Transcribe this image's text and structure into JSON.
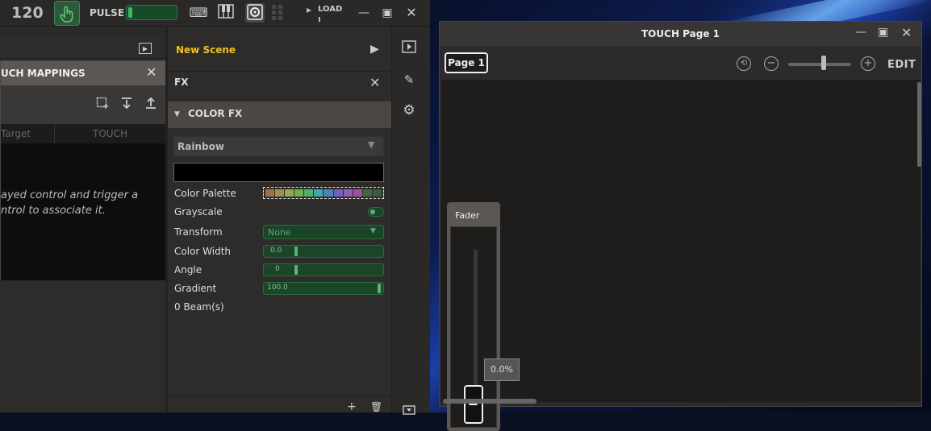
{
  "topbar": {
    "bpm": "120",
    "pulse_label": "PULSE",
    "load_label": "LOAD",
    "tools": [
      "keyboard-icon",
      "piano-icon",
      "speaker-icon",
      "grid-icon"
    ]
  },
  "mappings": {
    "title": "UCH MAPPINGS",
    "col_target": "Target",
    "col_touch": "TOUCH",
    "hint_line1": "ayed control and trigger a",
    "hint_line2": "ntrol to associate it."
  },
  "scene": {
    "title": "New Scene"
  },
  "fx": {
    "title": "FX",
    "section": "COLOR FX",
    "preset": "Rainbow",
    "props": {
      "color_palette": "Color Palette",
      "grayscale": "Grayscale",
      "transform": "Transform",
      "transform_value": "None",
      "color_width": "Color Width",
      "color_width_value": "0.0",
      "angle": "Angle",
      "angle_value": "0",
      "gradient": "Gradient",
      "gradient_value": "100.0",
      "beams": "0 Beam(s)"
    },
    "palette_colors": [
      "#a0704a",
      "#a09050",
      "#98a850",
      "#70b050",
      "#50b070",
      "#40a8a0",
      "#5080b8",
      "#7060b8",
      "#9060b0",
      "#a050a0",
      "#406840",
      "#405840"
    ],
    "slider_fractions": {
      "color_width": 0.25,
      "angle": 0.25,
      "gradient": 0.98
    }
  },
  "touch_window": {
    "title": "TOUCH Page 1",
    "page_tab": "Page 1",
    "edit_label": "EDIT",
    "fader_label": "Fader",
    "fader_value": "0.0%"
  }
}
